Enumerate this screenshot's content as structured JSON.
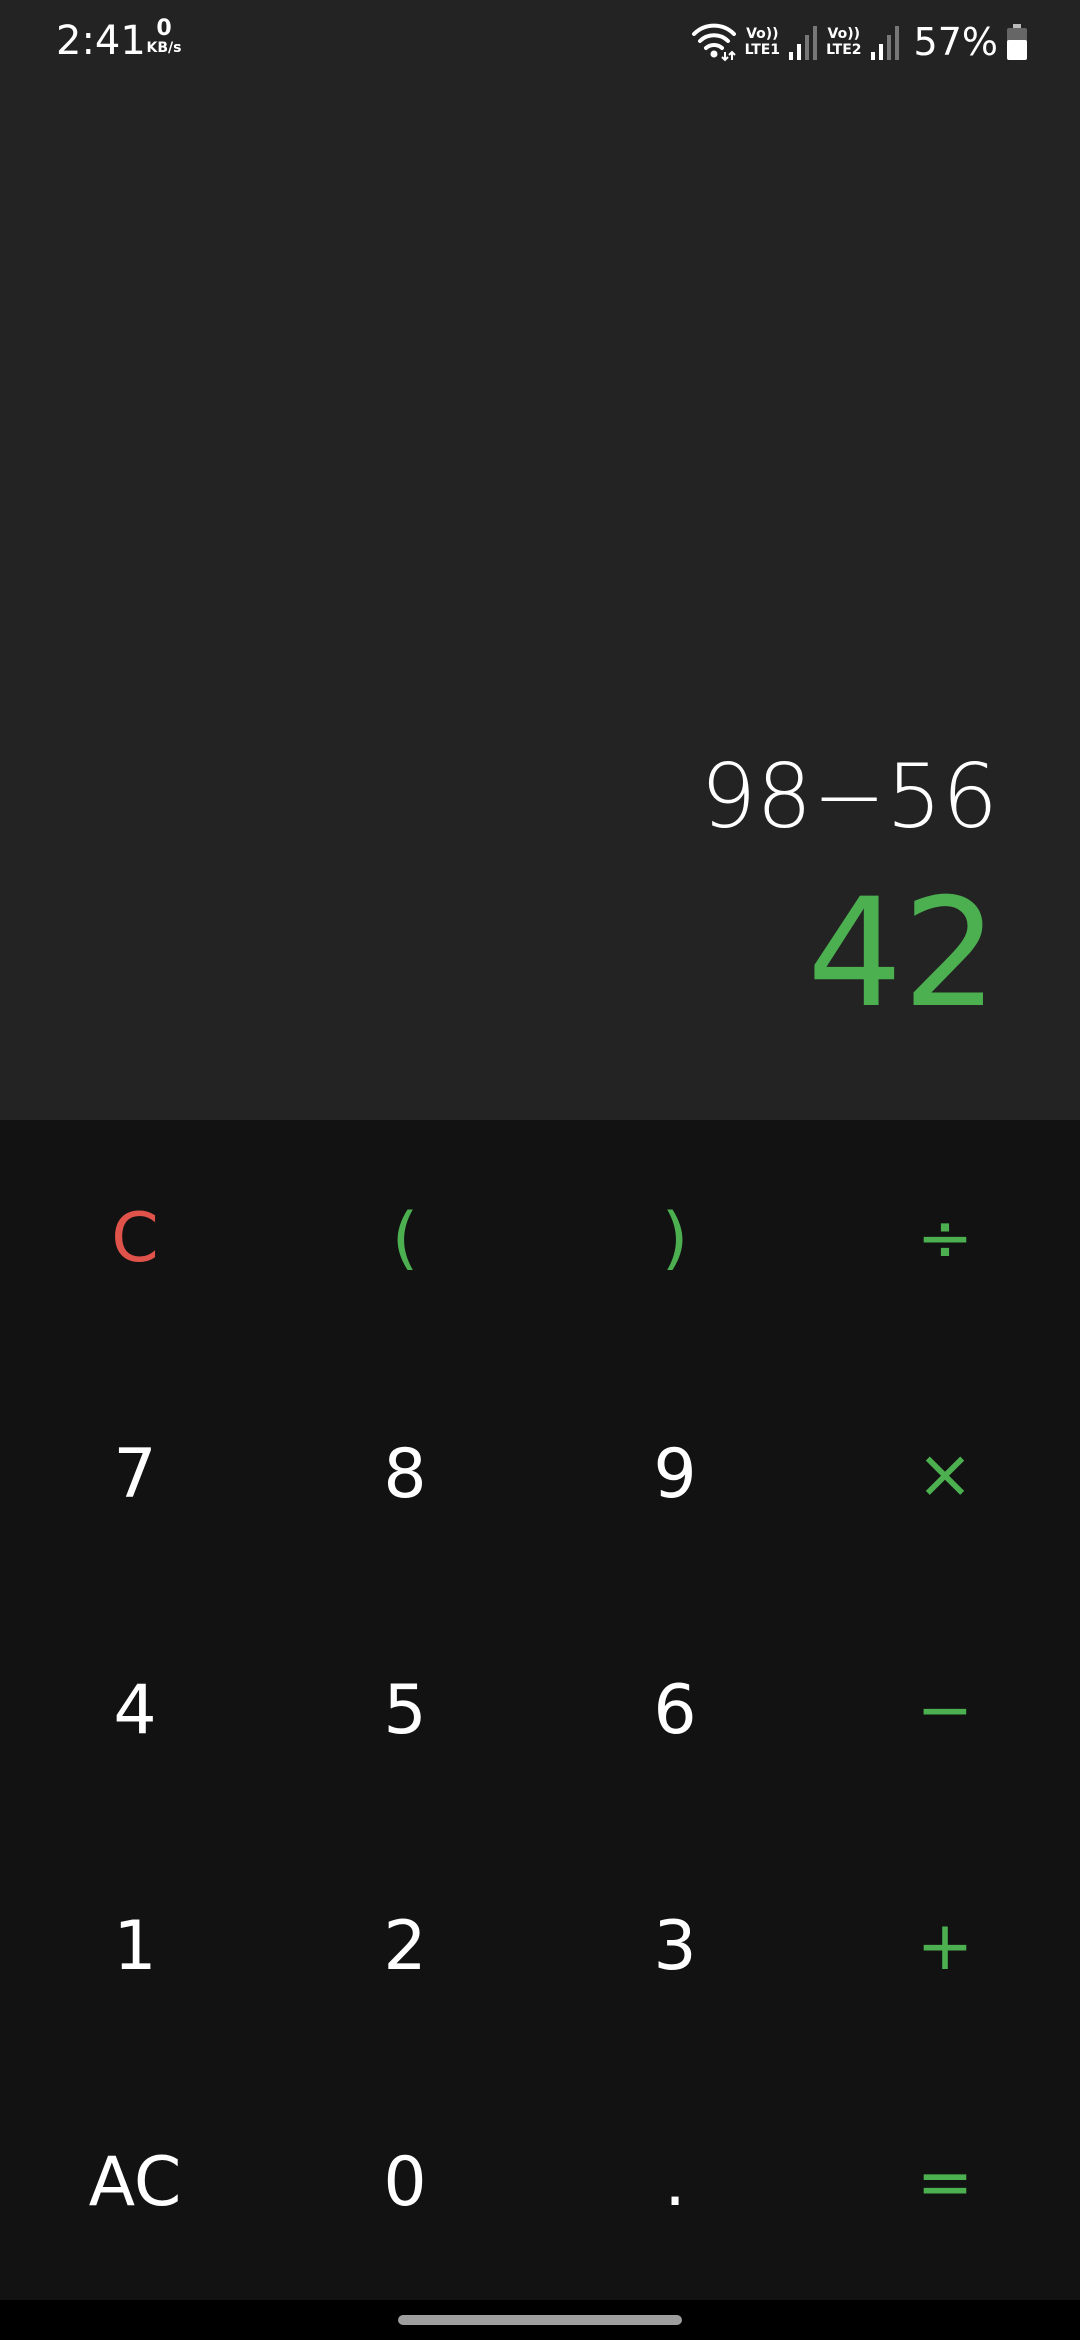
{
  "status_bar": {
    "time": "2:41",
    "net_speed_value": "0",
    "net_speed_unit": "KB/s",
    "sim1_label_top": "Vo))",
    "sim1_label_bottom": "LTE1",
    "sim2_label_top": "Vo))",
    "sim2_label_bottom": "LTE2",
    "battery_percent": "57%",
    "icons": [
      "wifi-icon",
      "signal-icon",
      "signal-icon",
      "battery-icon"
    ]
  },
  "display": {
    "expression": "98−56",
    "result": "42"
  },
  "keypad": {
    "keys": [
      {
        "label": "C",
        "name": "clear-button",
        "style": "red"
      },
      {
        "label": "(",
        "name": "open-paren-button",
        "style": "green"
      },
      {
        "label": ")",
        "name": "close-paren-button",
        "style": "green"
      },
      {
        "label": "÷",
        "name": "divide-button",
        "style": "green"
      },
      {
        "label": "7",
        "name": "digit-7-button",
        "style": "white"
      },
      {
        "label": "8",
        "name": "digit-8-button",
        "style": "white"
      },
      {
        "label": "9",
        "name": "digit-9-button",
        "style": "white"
      },
      {
        "label": "×",
        "name": "multiply-button",
        "style": "green"
      },
      {
        "label": "4",
        "name": "digit-4-button",
        "style": "white"
      },
      {
        "label": "5",
        "name": "digit-5-button",
        "style": "white"
      },
      {
        "label": "6",
        "name": "digit-6-button",
        "style": "white"
      },
      {
        "label": "−",
        "name": "subtract-button",
        "style": "green"
      },
      {
        "label": "1",
        "name": "digit-1-button",
        "style": "white"
      },
      {
        "label": "2",
        "name": "digit-2-button",
        "style": "white"
      },
      {
        "label": "3",
        "name": "digit-3-button",
        "style": "white"
      },
      {
        "label": "+",
        "name": "add-button",
        "style": "green"
      },
      {
        "label": "AC",
        "name": "all-clear-button",
        "style": "white"
      },
      {
        "label": "0",
        "name": "digit-0-button",
        "style": "white"
      },
      {
        "label": ".",
        "name": "decimal-button",
        "style": "white"
      },
      {
        "label": "=",
        "name": "equals-button",
        "style": "green"
      }
    ]
  },
  "colors": {
    "display_bg": "#232323",
    "keypad_bg": "#121212",
    "accent_green": "#4caf50",
    "clear_red": "#e0534a",
    "text_white": "#ffffff"
  }
}
